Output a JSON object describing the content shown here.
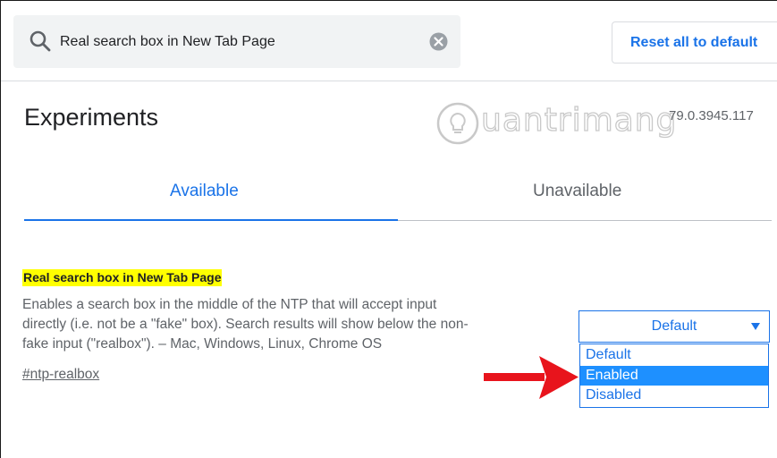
{
  "search": {
    "value": "Real search box in New Tab Page",
    "icon": "search-icon",
    "clear_icon": "clear-icon"
  },
  "toolbar": {
    "reset_label": "Reset all to default"
  },
  "page": {
    "title": "Experiments",
    "version": "79.0.3945.117",
    "watermark": "uantrimang"
  },
  "tabs": [
    {
      "label": "Available",
      "active": true
    },
    {
      "label": "Unavailable",
      "active": false
    }
  ],
  "experiment": {
    "title": "Real search box in New Tab Page",
    "description_lines": [
      "Enables a search box in the middle of the NTP that will accept input",
      "directly (i.e. not be a \"fake\" box). Search results will show below the non-",
      "fake input (\"realbox\"). – Mac, Windows, Linux, Chrome OS"
    ],
    "link": "#ntp-realbox",
    "select_value": "Default",
    "options": [
      "Default",
      "Enabled",
      "Disabled"
    ],
    "highlighted_option": "Enabled"
  },
  "colors": {
    "accent": "#1a73e8",
    "highlight": "#ffff00",
    "selected_option": "#1e90ff",
    "annotation_arrow": "#e8141c"
  }
}
